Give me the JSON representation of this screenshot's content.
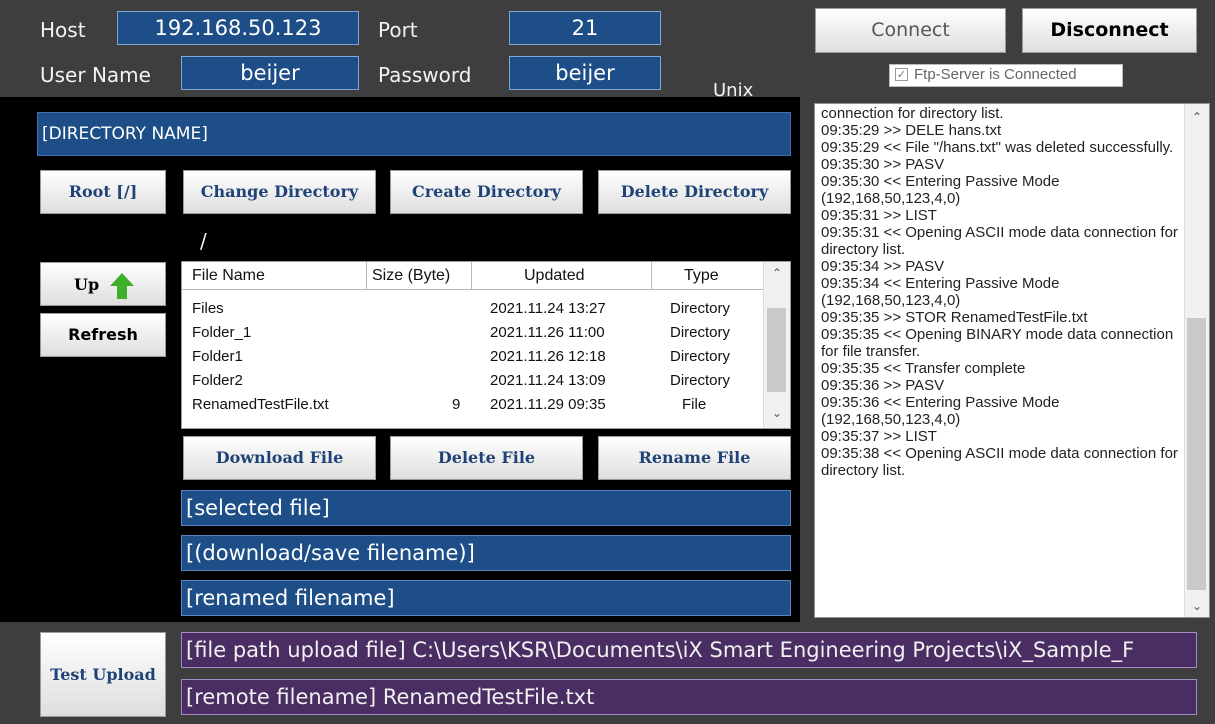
{
  "connection": {
    "host_label": "Host",
    "host_value": "192.168.50.123",
    "port_label": "Port",
    "port_value": "21",
    "user_label": "User Name",
    "user_value": "beijer",
    "password_label": "Password",
    "password_value": "beijer",
    "system_type": "Unix",
    "connect_label": "Connect",
    "disconnect_label": "Disconnect",
    "status_checkbox_label": "Ftp-Server is Connected",
    "status_checked": true
  },
  "directory": {
    "name_field": "[DIRECTORY NAME]",
    "root_label": "Root [/]",
    "change_label": "Change Directory",
    "create_label": "Create Directory",
    "delete_label": "Delete Directory",
    "current_path": "/",
    "up_label": "Up",
    "refresh_label": "Refresh"
  },
  "file_table": {
    "headers": [
      "File Name",
      "Size (Byte)",
      "Updated",
      "Type"
    ],
    "rows": [
      {
        "name": "Files",
        "size": "",
        "updated": "2021.11.24 13:27",
        "type": "Directory"
      },
      {
        "name": "Folder_1",
        "size": "",
        "updated": "2021.11.26 11:00",
        "type": "Directory"
      },
      {
        "name": "Folder1",
        "size": "",
        "updated": "2021.11.26 12:18",
        "type": "Directory"
      },
      {
        "name": "Folder2",
        "size": "",
        "updated": "2021.11.24 13:09",
        "type": "Directory"
      },
      {
        "name": "RenamedTestFile.txt",
        "size": "9",
        "updated": "2021.11.29 09:35",
        "type": "File"
      }
    ]
  },
  "file_actions": {
    "download_label": "Download File",
    "delete_label": "Delete File",
    "rename_label": "Rename File",
    "selected_file": "[selected file]",
    "download_filename": "[(download/save filename)]",
    "renamed_filename": "[renamed filename]"
  },
  "upload": {
    "button_label": "Test Upload",
    "file_path": "[file path upload file] C:\\Users\\KSR\\Documents\\iX Smart Engineering Projects\\iX_Sample_F",
    "remote_filename": "[remote filename] RenamedTestFile.txt"
  },
  "log": {
    "text": "connection for directory list.\n09:35:29 >> DELE hans.txt\n09:35:29 << File \"/hans.txt\" was deleted successfully.\n09:35:30 >> PASV\n09:35:30 << Entering Passive Mode (192,168,50,123,4,0)\n09:35:31 >> LIST\n09:35:31 << Opening ASCII mode data connection for directory list.\n09:35:34 >> PASV\n09:35:34 << Entering Passive Mode (192,168,50,123,4,0)\n09:35:35 >> STOR RenamedTestFile.txt\n09:35:35 << Opening BINARY mode data connection for file transfer.\n09:35:35 << Transfer complete\n09:35:36 >> PASV\n09:35:36 << Entering Passive Mode (192,168,50,123,4,0)\n09:35:37 >> LIST\n09:35:38 << Opening ASCII mode data connection for directory list."
  },
  "colors": {
    "field_blue": "#1d4e87",
    "field_purple": "#4a2e63",
    "up_arrow_green": "#3fae2a",
    "button_text": "#1f4377"
  }
}
